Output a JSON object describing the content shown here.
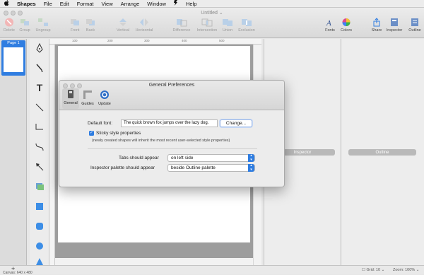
{
  "menubar": {
    "apple": "",
    "app_name": "Shapes",
    "items": [
      "File",
      "Edit",
      "Format",
      "View",
      "Arrange",
      "Window",
      "",
      "Help"
    ]
  },
  "window": {
    "document_title": "Untitled",
    "toolbar_left": [
      "Delete",
      "Group",
      "Ungroup",
      "Front",
      "Back",
      "Vertical",
      "Horizontal",
      "Difference",
      "Intersection",
      "Union",
      "Exclusion"
    ],
    "toolbar_right": [
      "Fonts",
      "Colors",
      "Share",
      "Inspector",
      "Outline"
    ]
  },
  "pages": {
    "page_label": "Page 1"
  },
  "rulers": {
    "top_ticks": [
      "100",
      "200",
      "300",
      "400",
      "500"
    ]
  },
  "panels": {
    "inspector_label": "Inspector",
    "outline_label": "Outline"
  },
  "statusbar": {
    "canvas_size": "Canvas: 640 x 480",
    "grid": "Grid: 10",
    "zoom": "Zoom: 100%",
    "add_button": "+"
  },
  "dialog": {
    "title": "General Preferences",
    "tabs": [
      "General",
      "Guides",
      "Update"
    ],
    "default_font_label": "Default font:",
    "default_font_value": "The quick brown fox jumps over the lazy dog.",
    "change_button": "Change...",
    "sticky_label": "Sticky style properties",
    "sticky_checked": true,
    "sticky_note": "(newly created shapes will inherit the most recent user-selected style properties)",
    "tabs_label": "Tabs should appear",
    "tabs_value": "on left side",
    "inspector_label": "Inspector palette should appear",
    "inspector_value": "beside Outline palette"
  },
  "colors": {
    "accent": "#2f7de1",
    "close": "#cfcfcf"
  }
}
